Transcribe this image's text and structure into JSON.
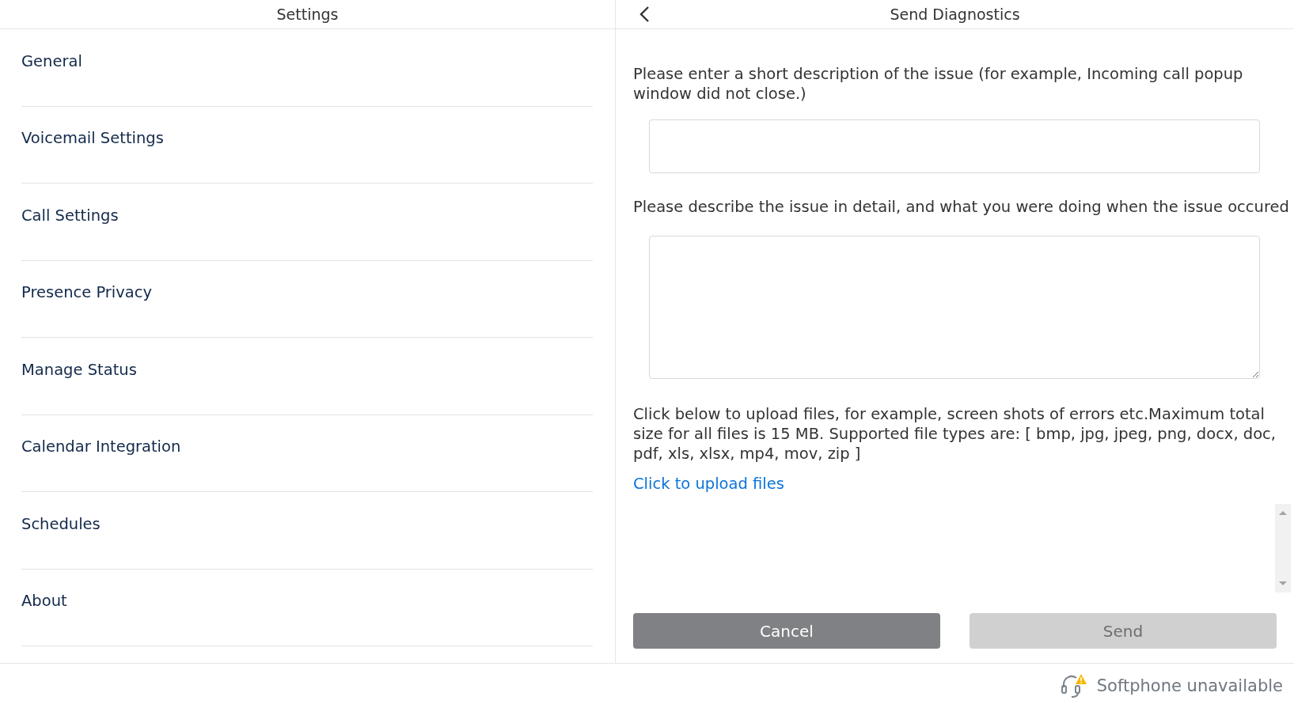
{
  "settings_panel": {
    "title": "Settings",
    "items": [
      {
        "label": "General"
      },
      {
        "label": "Voicemail Settings"
      },
      {
        "label": "Call Settings"
      },
      {
        "label": "Presence Privacy"
      },
      {
        "label": "Manage Status"
      },
      {
        "label": "Calendar Integration"
      },
      {
        "label": "Schedules"
      },
      {
        "label": "About"
      }
    ]
  },
  "diagnostics_panel": {
    "title": "Send Diagnostics",
    "fields": [
      {
        "kind": "input",
        "label": "Please enter a short description of the issue (for example, Incoming call popup window did not close.)"
      },
      {
        "kind": "textarea",
        "label": "Please describe the issue in detail, and what you were doing when the issue occured"
      }
    ],
    "upload_note": "Click below to upload files, for example, screen shots of errors etc.Maximum total size for all files is 15 MB. Supported file types are: [ bmp, jpg, jpeg, png, docx, doc, pdf, xls, xlsx, mp4, mov, zip ]",
    "upload_link": "Click to upload files",
    "buttons": [
      {
        "label": "Cancel",
        "disabled": false
      },
      {
        "label": "Send",
        "disabled": true
      }
    ]
  },
  "status_bar": {
    "text": "Softphone unavailable",
    "warning": true
  }
}
